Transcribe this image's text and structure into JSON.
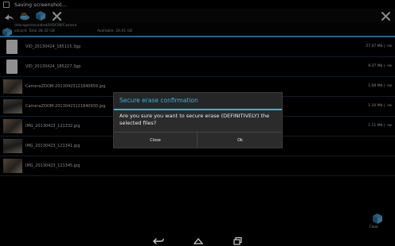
{
  "statusbar": {
    "text": "Saving screenshot...",
    "icon": "download-icon"
  },
  "toolbar": {
    "icons": [
      "share-icon",
      "cloud-icon",
      "save-icon",
      "archive-icon",
      "delete-icon"
    ],
    "right_icon": "close-icon"
  },
  "pathbar": {
    "path": "/storage/emulated/0/DCIM/Camera",
    "sdcard": "sdcard: Total 28.32 GB",
    "available": "Available: 26.01 GB"
  },
  "files": [
    {
      "name": "VID_20130424_185115.3gp",
      "size": "57.07 Mb | -rw",
      "thumb": "doc"
    },
    {
      "name": "VID_20130424_185227.3gp",
      "size": "9.37 Mb | -rw",
      "thumb": "doc"
    },
    {
      "name": "CameraZOOM-20130423121840659.jpg",
      "size": "1.08 Mb | -rw",
      "thumb": "photo"
    },
    {
      "name": "CameraZOOM-20130423121840930.jpg",
      "size": "1.10 Mb | -rw",
      "thumb": "photo2"
    },
    {
      "name": "IMG_20130423_121332.jpg",
      "size": "1.11 Mb | -rw",
      "thumb": "photo"
    },
    {
      "name": "IMG_20130423_121341.jpg",
      "size": "",
      "thumb": "photo2"
    },
    {
      "name": "IMG_20130423_121345.jpg",
      "size": "",
      "thumb": "photo"
    }
  ],
  "dialog": {
    "title": "Secure erase confirmation",
    "message": "Are you sure you want to secure erase (DEFINITIVELY) the selected files?",
    "close_label": "Close",
    "ok_label": "Ok"
  },
  "close_fab": {
    "label": "Close"
  },
  "navbar": {
    "icons": [
      "back-icon",
      "home-icon",
      "recents-icon"
    ]
  },
  "colors": {
    "accent": "#33b5e5",
    "background": "#000000",
    "dialog": "#2b2b2b"
  }
}
